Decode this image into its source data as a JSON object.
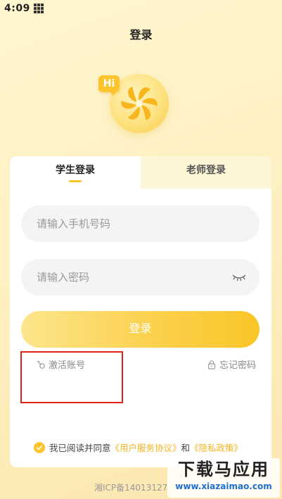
{
  "status_bar": {
    "time": "4:09"
  },
  "header": {
    "title": "登录"
  },
  "logo": {
    "badge_text": "Hi"
  },
  "tabs": [
    {
      "label": "学生登录",
      "active": true
    },
    {
      "label": "老师登录",
      "active": false
    }
  ],
  "form": {
    "phone_placeholder": "请输入手机号码",
    "password_placeholder": "请输入密码",
    "login_label": "登录"
  },
  "links": {
    "activate": "激活账号",
    "forgot": "忘记密码"
  },
  "agreement": {
    "prefix": "我已阅读并同意",
    "service": "《用户服务协议》",
    "and": "和",
    "privacy": "《隐私政策》"
  },
  "footer": {
    "icp": "湘ICP备14013127"
  },
  "watermark": {
    "main": "下载马应用",
    "sub": "www.xiazaimao.com"
  },
  "colors": {
    "accent": "#fcc52d",
    "link": "#f3b51f",
    "highlight": "#e0201b"
  }
}
